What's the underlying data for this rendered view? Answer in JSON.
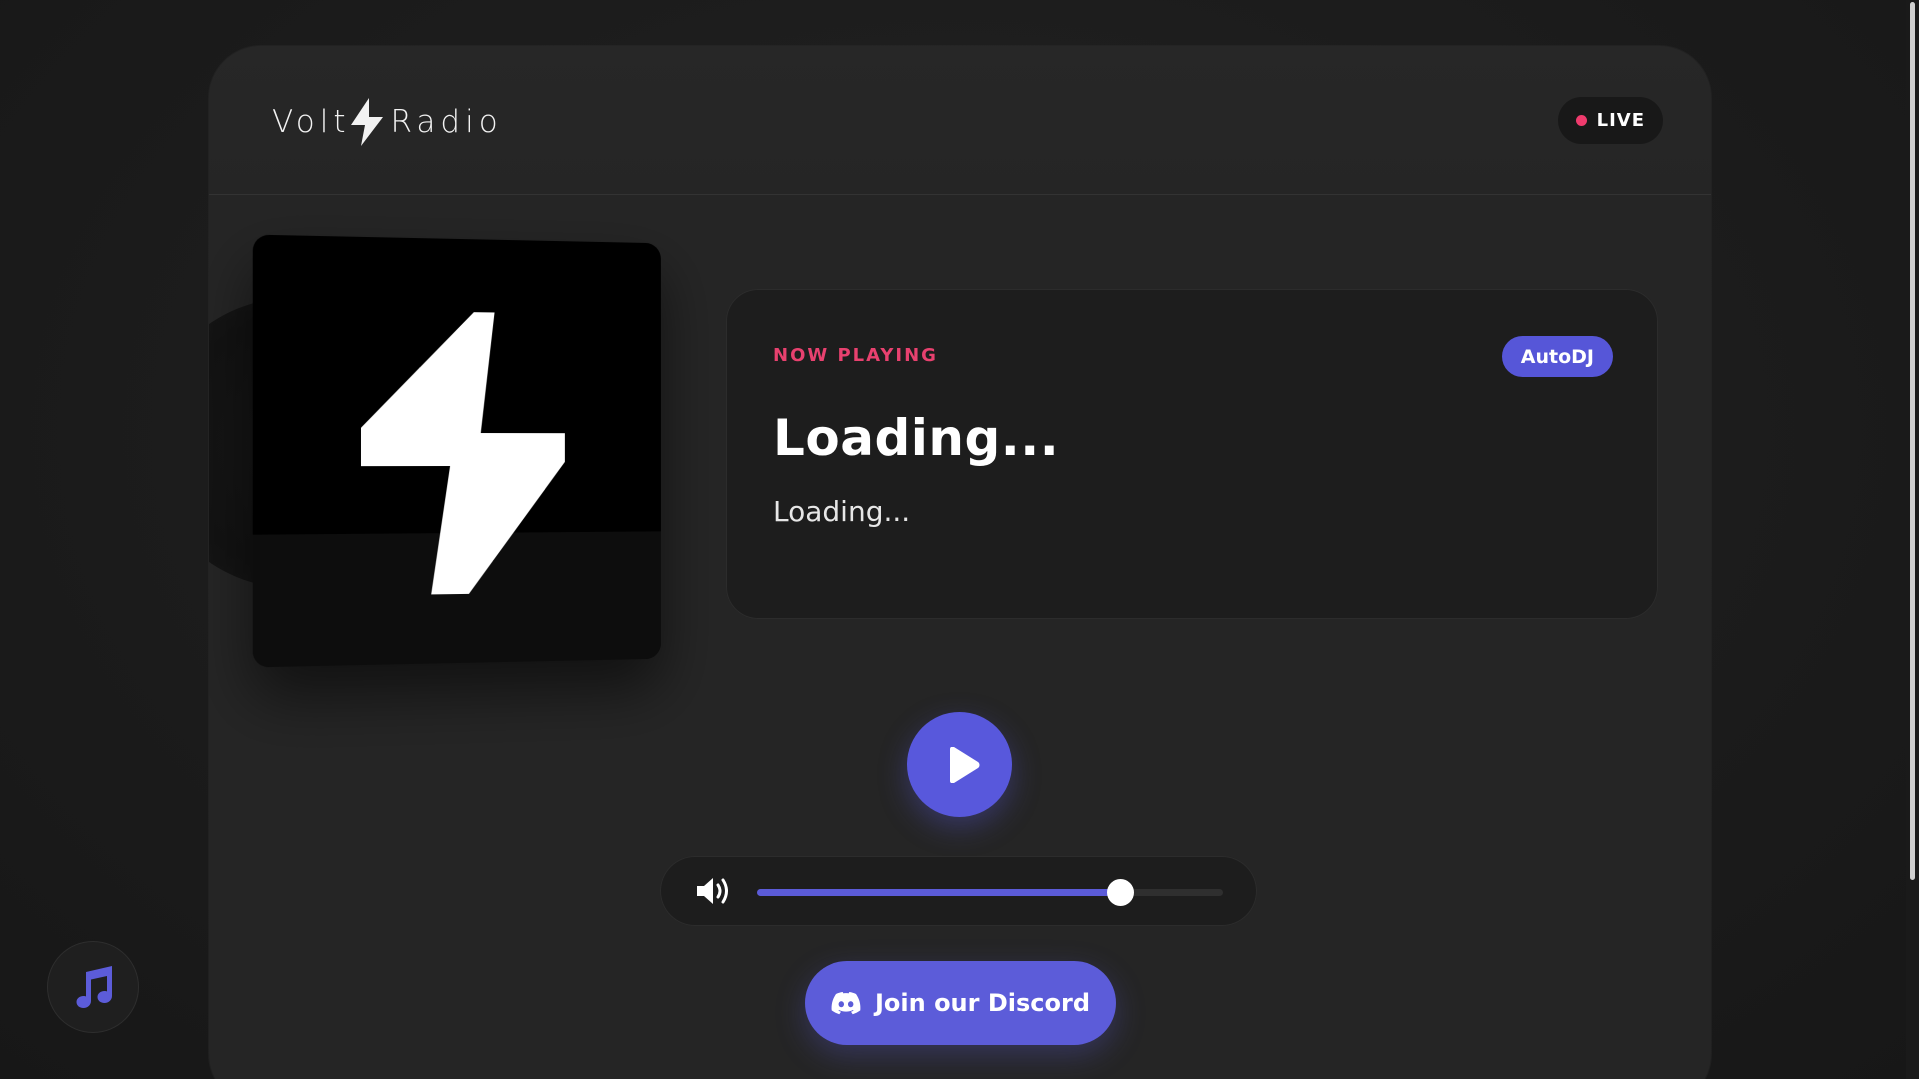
{
  "header": {
    "logo_left": "Volt",
    "logo_right": "Radio",
    "live_label": "LIVE"
  },
  "now_playing": {
    "label": "NOW PLAYING",
    "badge": "AutoDJ",
    "title": "Loading...",
    "artist": "Loading..."
  },
  "volume": {
    "level_percent": 78
  },
  "discord_button": {
    "label": "Join our Discord"
  },
  "icons": {
    "logo": "lightning-bolt-icon",
    "album": "lightning-bolt-icon",
    "play": "play-icon",
    "volume": "speaker-icon",
    "discord": "discord-icon",
    "music": "music-note-icon"
  },
  "colors": {
    "accent": "#5858dc",
    "live_dot": "#ef3b6d",
    "now_playing_label": "#e8416f",
    "background": "#1b1b1b",
    "card": "#252525"
  }
}
